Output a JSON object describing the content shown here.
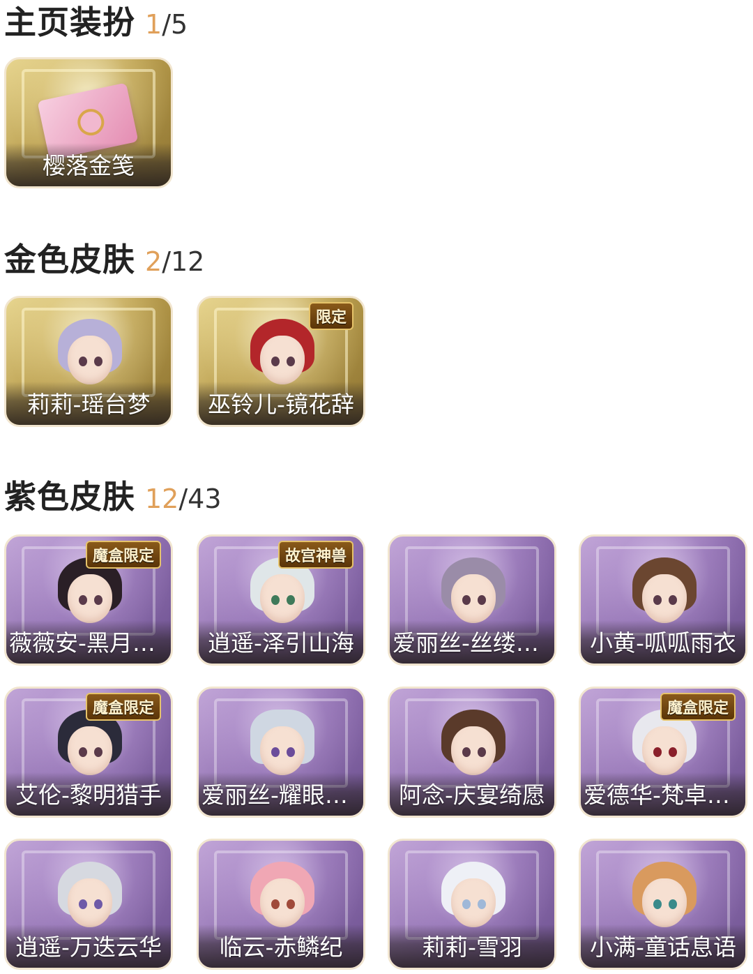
{
  "sections": [
    {
      "title": "主页装扮",
      "owned": "1",
      "total": "/5",
      "items": [
        {
          "label": "樱落金笺",
          "theme": "gold",
          "art": "pink-envelope",
          "badge": ""
        }
      ]
    },
    {
      "title": "金色皮肤",
      "owned": "2",
      "total": "/12",
      "items": [
        {
          "label": "莉莉-瑶台梦",
          "theme": "gold",
          "art": "lavender-hair-portrait",
          "badge": ""
        },
        {
          "label": "巫铃儿-镜花辞",
          "theme": "gold",
          "art": "red-hood-portrait",
          "badge": "限定"
        }
      ]
    },
    {
      "title": "紫色皮肤",
      "owned": "12",
      "total": "/43",
      "items": [
        {
          "label": "薇薇安-黑月挽…",
          "theme": "purple",
          "art": "dark-curly-hair-portrait",
          "badge": "魔盒限定"
        },
        {
          "label": "逍遥-泽引山海",
          "theme": "purple",
          "art": "silver-hair-portrait",
          "badge": "故宫神兽"
        },
        {
          "label": "爱丽丝-丝缕哀…",
          "theme": "purple",
          "art": "flower-crown-portrait",
          "badge": ""
        },
        {
          "label": "小黄-呱呱雨衣",
          "theme": "purple",
          "art": "frog-hat-portrait",
          "badge": ""
        },
        {
          "label": "艾伦-黎明猎手",
          "theme": "purple",
          "art": "dark-hair-portrait",
          "badge": "魔盒限定"
        },
        {
          "label": "爱丽丝-耀眼的…",
          "theme": "purple",
          "art": "cowboy-hat-portrait",
          "badge": ""
        },
        {
          "label": "阿念-庆宴绮愿",
          "theme": "purple",
          "art": "party-hat-portrait",
          "badge": ""
        },
        {
          "label": "爱德华-梵卓之…",
          "theme": "purple",
          "art": "white-hair-portrait",
          "badge": "魔盒限定"
        },
        {
          "label": "逍遥-万迭云华",
          "theme": "purple",
          "art": "silver-long-hair-portrait",
          "badge": ""
        },
        {
          "label": "临云-赤鳞纪",
          "theme": "purple",
          "art": "pink-dragon-hair-portrait",
          "badge": ""
        },
        {
          "label": "莉莉-雪羽",
          "theme": "purple",
          "art": "white-wing-hair-portrait",
          "badge": ""
        },
        {
          "label": "小满-童话息语",
          "theme": "purple",
          "art": "ginger-hair-portrait",
          "badge": ""
        }
      ]
    }
  ],
  "colors": {
    "owned_count": "#e0a05a",
    "title": "#222222"
  }
}
